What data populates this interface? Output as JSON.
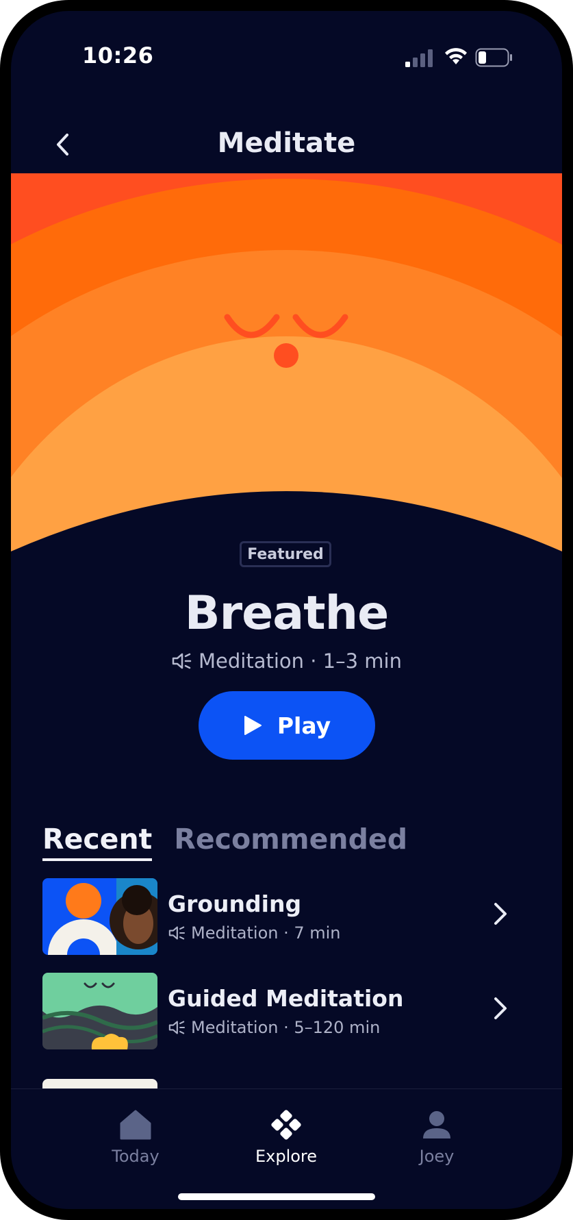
{
  "status_bar": {
    "time": "10:26"
  },
  "header": {
    "title": "Meditate"
  },
  "featured": {
    "badge": "Featured",
    "title": "Breathe",
    "meta": "Meditation · 1–3 min",
    "play_label": "Play"
  },
  "tabs": [
    {
      "label": "Recent",
      "active": true
    },
    {
      "label": "Recommended",
      "active": false
    }
  ],
  "items": [
    {
      "title": "Grounding",
      "meta": "Meditation · 7 min"
    },
    {
      "title": "Guided Meditation",
      "meta": "Meditation · 5–120 min"
    }
  ],
  "bottom_nav": [
    {
      "label": "Today",
      "icon": "home-icon",
      "active": false
    },
    {
      "label": "Explore",
      "icon": "explore-icon",
      "active": true
    },
    {
      "label": "Joey",
      "icon": "profile-icon",
      "active": false
    }
  ],
  "colors": {
    "background": "#050926",
    "accent": "#0c53f5",
    "hero_orange": "#ff6b0a"
  }
}
